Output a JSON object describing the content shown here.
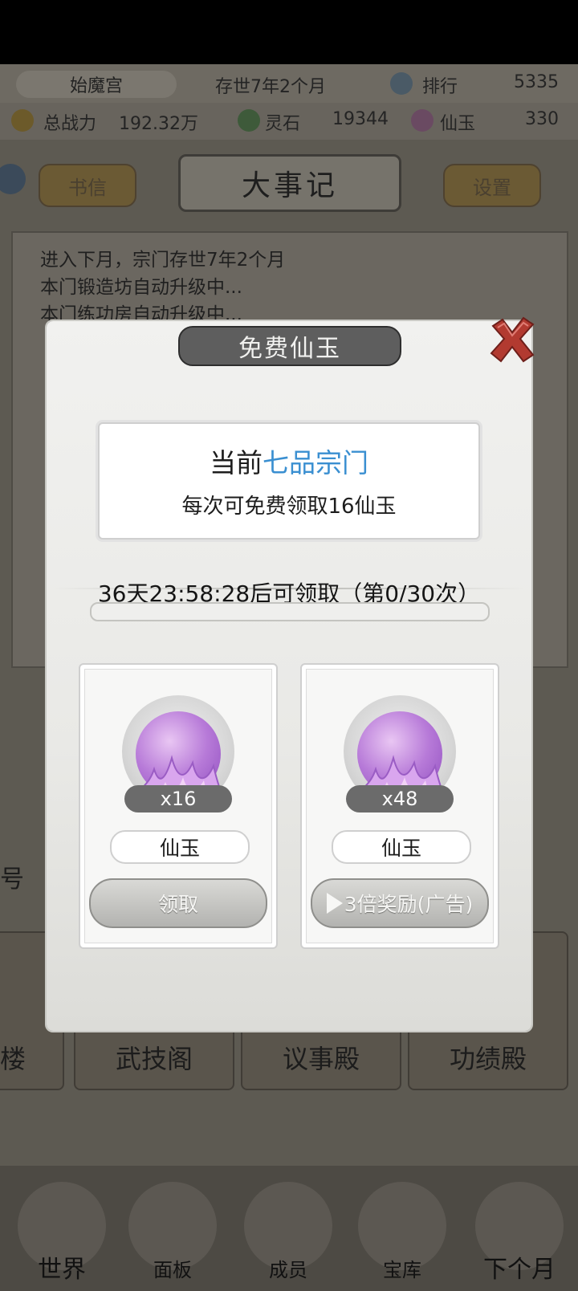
{
  "hud": {
    "sect_name": "始魔宫",
    "existence": "存世7年2个月",
    "ranking_label": "排行",
    "ranking_value": "5335",
    "power_label": "总战力",
    "power_value": "192.32万",
    "spirit_stone_label": "灵石",
    "spirit_stone_value": "19344",
    "jade_label": "仙玉",
    "jade_value": "330"
  },
  "header": {
    "letters_button": "书信",
    "title": "大事记",
    "settings_button": "设置"
  },
  "log": {
    "lines": [
      "进入下月，宗门存世7年2个月",
      "本门锻造坊自动升级中...",
      "本门练功房自动升级中..."
    ]
  },
  "buildings": {
    "left_partial_top": "号",
    "left_partial_bottom": "楼",
    "items": [
      "武技阁",
      "议事殿",
      "功绩殿"
    ]
  },
  "bottom_nav": {
    "items": [
      "世界",
      "面板",
      "成员",
      "宝库",
      "下个月"
    ]
  },
  "modal": {
    "title": "免费仙玉",
    "info_prefix": "当前",
    "info_accent": "七品宗门",
    "info_line2": "每次可免费领取16仙玉",
    "timer_text": "36天23:58:28后可领取（第0/30次）",
    "accent_color": "#3a8fd1",
    "cards": [
      {
        "quantity": "x16",
        "name": "仙玉",
        "button": "领取",
        "icon": "purple-jade-orb-icon"
      },
      {
        "quantity": "x48",
        "name": "仙玉",
        "button": "3倍奖励(广告)",
        "icon": "purple-jade-orb-icon"
      }
    ]
  }
}
